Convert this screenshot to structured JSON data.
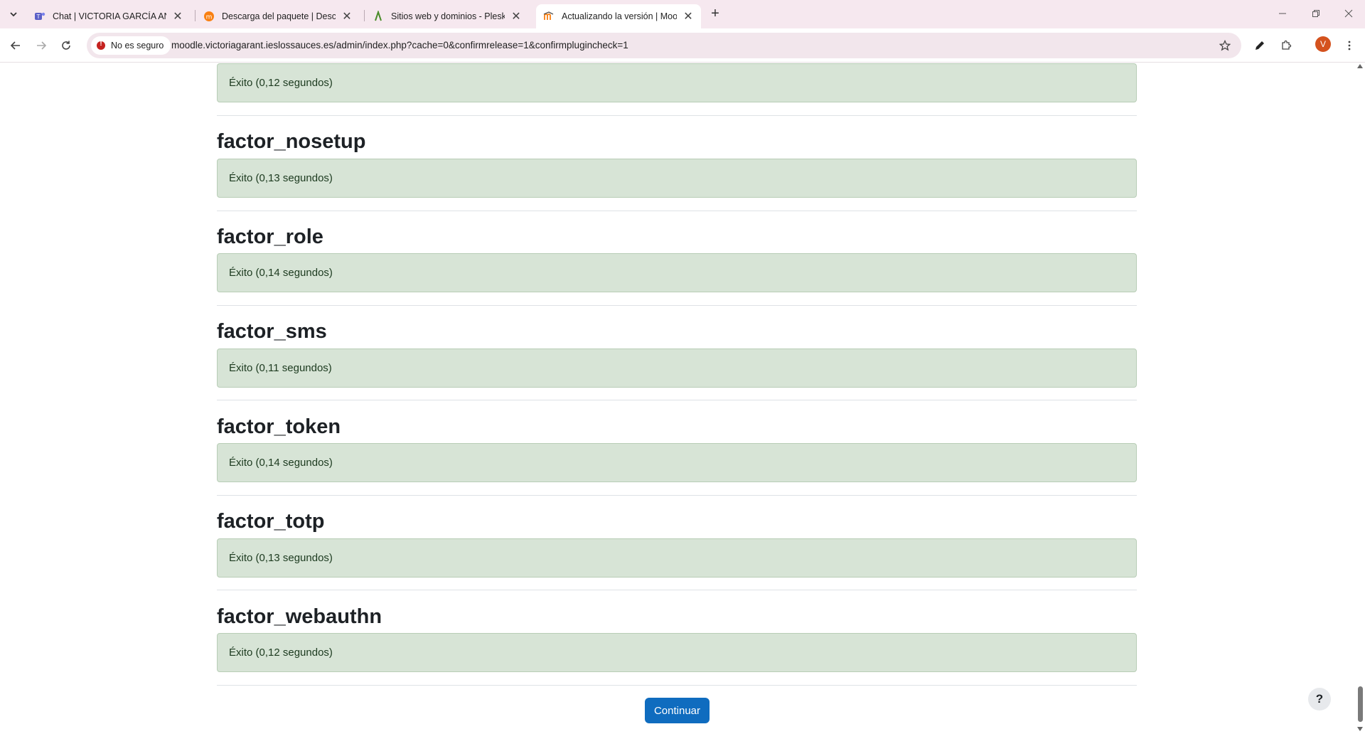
{
  "browser": {
    "tabs": [
      {
        "title": "Chat | VICTORIA GARCÍA ANTÓN",
        "icon": "teams-icon",
        "active": false
      },
      {
        "title": "Descarga del paquete | Descarga",
        "icon": "moodle-orange-icon",
        "active": false
      },
      {
        "title": "Sitios web y dominios - Plesk -",
        "icon": "plesk-icon",
        "active": false
      },
      {
        "title": "Actualizando la versión | Moodle",
        "icon": "moodle-icon",
        "active": true
      }
    ],
    "security_label": "No es seguro",
    "url": "moodle.victoriagarant.ieslossauces.es/admin/index.php?cache=0&confirmrelease=1&confirmplugincheck=1",
    "profile_initial": "V"
  },
  "page": {
    "first_result": "Éxito (0,12 segundos)",
    "plugins": [
      {
        "name": "factor_nosetup",
        "result": "Éxito (0,13 segundos)"
      },
      {
        "name": "factor_role",
        "result": "Éxito (0,14 segundos)"
      },
      {
        "name": "factor_sms",
        "result": "Éxito (0,11 segundos)"
      },
      {
        "name": "factor_token",
        "result": "Éxito (0,14 segundos)"
      },
      {
        "name": "factor_totp",
        "result": "Éxito (0,13 segundos)"
      },
      {
        "name": "factor_webauthn",
        "result": "Éxito (0,12 segundos)"
      }
    ],
    "continue_label": "Continuar",
    "help_label": "?"
  },
  "colors": {
    "success_bg": "#d7e4d6",
    "primary": "#0f6cbf",
    "tabstrip_bg": "#f6e8ef"
  }
}
